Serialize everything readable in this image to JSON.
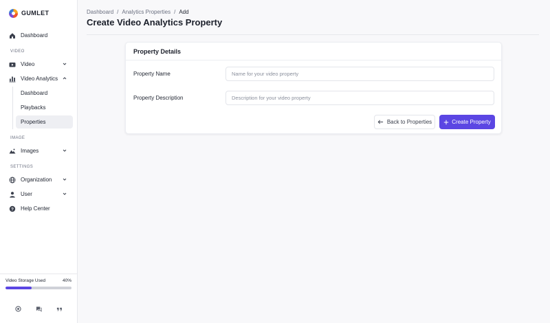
{
  "brand": {
    "name": "GUMLET"
  },
  "sidebar": {
    "dashboard": "Dashboard",
    "sections": {
      "video": "VIDEO",
      "image": "IMAGE",
      "settings": "SETTINGS"
    },
    "video": "Video",
    "video_analytics": "Video Analytics",
    "sub_items": [
      "Dashboard",
      "Playbacks",
      "Properties"
    ],
    "images": "Images",
    "organization": "Organization",
    "user": "User",
    "help_center": "Help Center",
    "storage": {
      "label": "Video Storage Used",
      "percent_text": "40%",
      "percent": 40
    }
  },
  "breadcrumb": {
    "items": [
      "Dashboard",
      "Analytics Properties",
      "Add"
    ],
    "separator": "/"
  },
  "page": {
    "title": "Create Video Analytics Property"
  },
  "card": {
    "title": "Property Details",
    "fields": {
      "name": {
        "label": "Property Name",
        "placeholder": "Name for your video property",
        "value": ""
      },
      "description": {
        "label": "Property Description",
        "placeholder": "Description for your video property",
        "value": ""
      }
    },
    "back_label": "Back to Properties",
    "create_label": "Create Property"
  },
  "colors": {
    "accent": "#5b46e3",
    "active_bg": "#eeeff3"
  },
  "icons": {
    "dashboard": "home-icon",
    "video": "video-icon",
    "analytics": "bar-chart-icon",
    "images": "image-icon",
    "organization": "globe-icon",
    "user": "user-icon",
    "help": "help-circle-icon"
  }
}
